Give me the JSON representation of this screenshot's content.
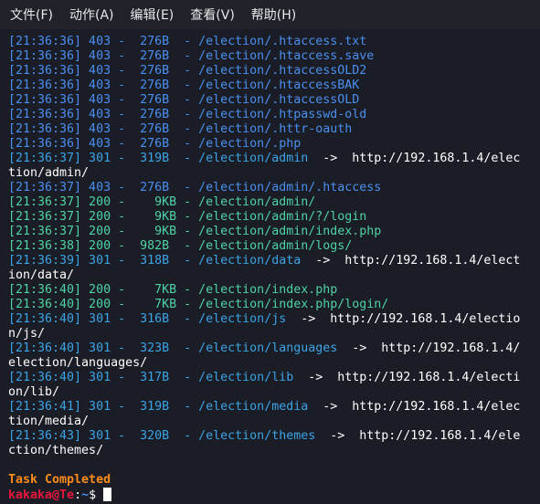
{
  "menu": [
    "文件(F)",
    "动作(A)",
    "编辑(E)",
    "查看(V)",
    "帮助(H)"
  ],
  "lines": [
    {
      "text": "[21:36:36] 403 -  276B  - /election/.htaccess.txt",
      "color": "blue"
    },
    {
      "text": "[21:36:36] 403 -  276B  - /election/.htaccess.save",
      "color": "blue"
    },
    {
      "text": "[21:36:36] 403 -  276B  - /election/.htaccessOLD2",
      "color": "blue"
    },
    {
      "text": "[21:36:36] 403 -  276B  - /election/.htaccessBAK",
      "color": "blue"
    },
    {
      "text": "[21:36:36] 403 -  276B  - /election/.htaccessOLD",
      "color": "blue"
    },
    {
      "text": "[21:36:36] 403 -  276B  - /election/.htpasswd-old",
      "color": "blue"
    },
    {
      "text": "[21:36:36] 403 -  276B  - /election/.httr-oauth",
      "color": "blue"
    },
    {
      "text": "[21:36:36] 403 -  276B  - /election/.php",
      "color": "blue"
    },
    {
      "text": "[21:36:37] 301 -  319B  - /election/admin",
      "color": "cyan",
      "redirect": "  ->  http://192.168.1.4/elec",
      "cont": "tion/admin/"
    },
    {
      "text": "[21:36:37] 403 -  276B  - /election/admin/.htaccess",
      "color": "blue"
    },
    {
      "text": "[21:36:37] 200 -    9KB - /election/admin/",
      "color": "green"
    },
    {
      "text": "[21:36:37] 200 -    9KB - /election/admin/?/login",
      "color": "green"
    },
    {
      "text": "[21:36:37] 200 -    9KB - /election/admin/index.php",
      "color": "green"
    },
    {
      "text": "[21:36:38] 200 -  982B  - /election/admin/logs/",
      "color": "green"
    },
    {
      "text": "[21:36:39] 301 -  318B  - /election/data",
      "color": "cyan",
      "redirect": "  ->  http://192.168.1.4/elect",
      "cont": "ion/data/"
    },
    {
      "text": "[21:36:40] 200 -    7KB - /election/index.php",
      "color": "green"
    },
    {
      "text": "[21:36:40] 200 -    7KB - /election/index.php/login/",
      "color": "green"
    },
    {
      "text": "[21:36:40] 301 -  316B  - /election/js",
      "color": "cyan",
      "redirect": "  ->  http://192.168.1.4/electio",
      "cont": "n/js/"
    },
    {
      "text": "[21:36:40] 301 -  323B  - /election/languages",
      "color": "cyan",
      "redirect": "  ->  http://192.168.1.4/",
      "cont": "election/languages/"
    },
    {
      "text": "[21:36:40] 301 -  317B  - /election/lib",
      "color": "cyan",
      "redirect": "  ->  http://192.168.1.4/electi",
      "cont": "on/lib/"
    },
    {
      "text": "[21:36:41] 301 -  319B  - /election/media",
      "color": "cyan",
      "redirect": "  ->  http://192.168.1.4/elec",
      "cont": "tion/media/"
    },
    {
      "text": "[21:36:43] 301 -  320B  - /election/themes",
      "color": "cyan",
      "redirect": "  ->  http://192.168.1.4/ele",
      "cont": "ction/themes/"
    }
  ],
  "task_completed": "Task Completed",
  "prompt": {
    "user_host": "kakaka@Te",
    "sep": ":",
    "path": "~",
    "symbol": "$ "
  }
}
